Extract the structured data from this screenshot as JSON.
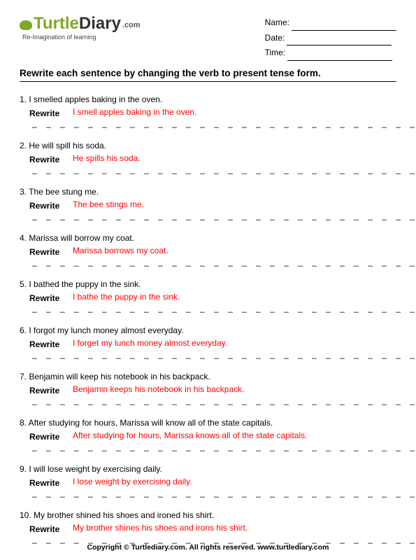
{
  "logo": {
    "brand1": "Turtle",
    "brand2": "Diary",
    "com": ".com",
    "tagline": "Re-Imagination of learning"
  },
  "meta": {
    "name_label": "Name:",
    "date_label": "Date:",
    "time_label": "Time:"
  },
  "instruction": "Rewrite each sentence by changing the verb to present tense form.",
  "rewrite_label": "Rewrite",
  "items": [
    {
      "n": "1.",
      "prompt": "I smelled apples baking in the oven.",
      "answer": "I smell apples baking in the oven."
    },
    {
      "n": "2.",
      "prompt": "He will spill his soda.",
      "answer": "He spills his soda."
    },
    {
      "n": "3.",
      "prompt": "The bee stung me.",
      "answer": "The bee stings me."
    },
    {
      "n": "4.",
      "prompt": "Marissa will borrow my coat.",
      "answer": "Marissa borrows my coat."
    },
    {
      "n": "5.",
      "prompt": "I bathed the puppy in the sink.",
      "answer": "I bathe the puppy in the sink."
    },
    {
      "n": "6.",
      "prompt": "I forgot my lunch money almost everyday.",
      "answer": "I forget my lunch money almost everyday."
    },
    {
      "n": "7.",
      "prompt": "Benjamin will keep his notebook in his backpack.",
      "answer": "Benjamin keeps his notebook in his backpack."
    },
    {
      "n": "8.",
      "prompt": "After studying for hours, Marissa will know all of the state capitals.",
      "answer": "After studying for hours, Marissa knows all of the state capitals."
    },
    {
      "n": "9.",
      "prompt": "I will lose weight by exercising daily.",
      "answer": "I lose weight by exercising daily."
    },
    {
      "n": "10.",
      "prompt": "My brother shined his shoes and ironed his shirt.",
      "answer": "My brother shines his shoes and irons his shirt."
    }
  ],
  "footer": "Copyright © Turtlediary.com. All rights reserved. www.turtlediary.com",
  "dashes": "_ _ _ _ _ _ _ _ _ _ _ _ _ _ _ _ _ _ _ _ _ _ _ _ _ _ _ _ _ _ _"
}
